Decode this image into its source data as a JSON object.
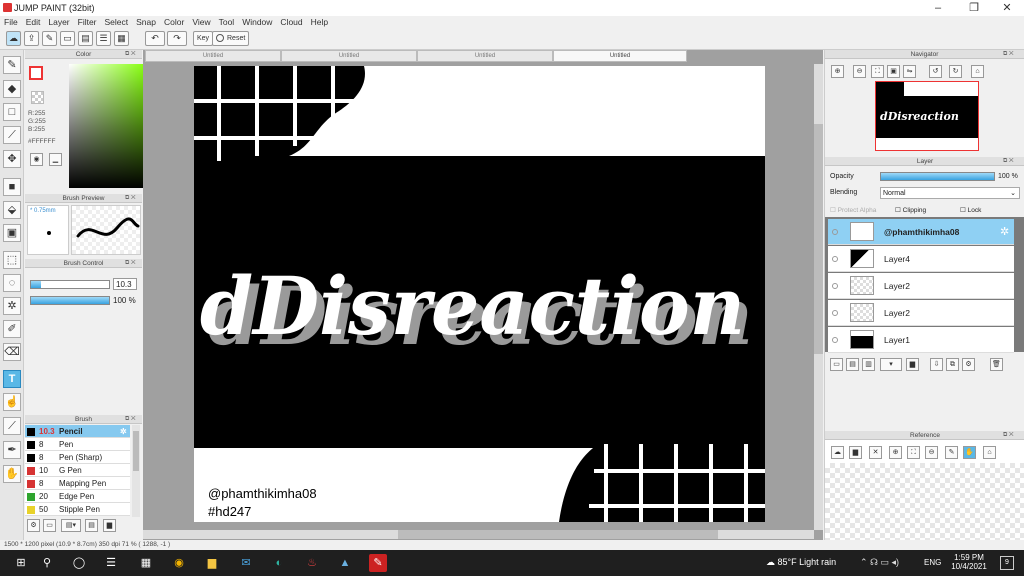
{
  "app": {
    "title": "JUMP PAINT (32bit)",
    "minimize": "–",
    "maximize": "❐",
    "close": "✕"
  },
  "menu": [
    "File",
    "Edit",
    "Layer",
    "Filter",
    "Select",
    "Snap",
    "Color",
    "View",
    "Tool",
    "Window",
    "Cloud",
    "Help"
  ],
  "toolbar": {
    "key_label": "Key",
    "reset_label": "Reset",
    "undo": "↶",
    "redo": "↷"
  },
  "color_panel": {
    "title": "Color",
    "r": "R:255",
    "g": "G:255",
    "b": "B:255",
    "hex": "#FFFFFF"
  },
  "brush_preview": {
    "title": "Brush Preview",
    "size_label": "* 0.75mm"
  },
  "brush_control": {
    "title": "Brush Control",
    "size_value": "10.3",
    "opacity_value": "100 %",
    "size_fraction": 0.13,
    "opacity_fraction": 1.0
  },
  "brush_list": {
    "title": "Brush",
    "items": [
      {
        "size": "10.3",
        "name": "Pencil",
        "color": "#000000",
        "selected": true
      },
      {
        "size": "8",
        "name": "Pen",
        "color": "#000000"
      },
      {
        "size": "8",
        "name": "Pen (Sharp)",
        "color": "#000000"
      },
      {
        "size": "10",
        "name": "G Pen",
        "color": "#d63333"
      },
      {
        "size": "8",
        "name": "Mapping Pen",
        "color": "#d63333"
      },
      {
        "size": "20",
        "name": "Edge Pen",
        "color": "#2fa52f"
      },
      {
        "size": "50",
        "name": "Stipple Pen",
        "color": "#e8d22a"
      }
    ]
  },
  "doc_tabs": [
    "Untitled",
    "Untitled",
    "Untitled",
    "Untitled"
  ],
  "artwork": {
    "headline": "dDisreaction",
    "handle": "@phamthikimha08",
    "hashtag": "#hd247"
  },
  "navigator": {
    "title": "Navigator",
    "thumb_text": "dDisreaction"
  },
  "layer_panel": {
    "title": "Layer",
    "opacity_label": "Opacity",
    "opacity_value": "100 %",
    "opacity_fraction": 1.0,
    "blending_label": "Blending",
    "blending_value": "Normal",
    "protect_alpha": "Protect Alpha",
    "clipping": "Clipping",
    "lock": "Lock",
    "layers": [
      {
        "name": "@phamthikimha08",
        "selected": true
      },
      {
        "name": "Layer4"
      },
      {
        "name": "Layer2"
      },
      {
        "name": "Layer2"
      },
      {
        "name": "Layer1"
      }
    ]
  },
  "reference": {
    "title": "Reference"
  },
  "status": {
    "text": "1500 * 1200 pixel   (10.9 * 8.7cm)   350 dpi   71 %   ( 1288, -1 )"
  },
  "taskbar": {
    "weather": "85°F  Light rain",
    "lang": "ENG",
    "time": "1:59 PM",
    "date": "10/4/2021",
    "notif": "9"
  }
}
